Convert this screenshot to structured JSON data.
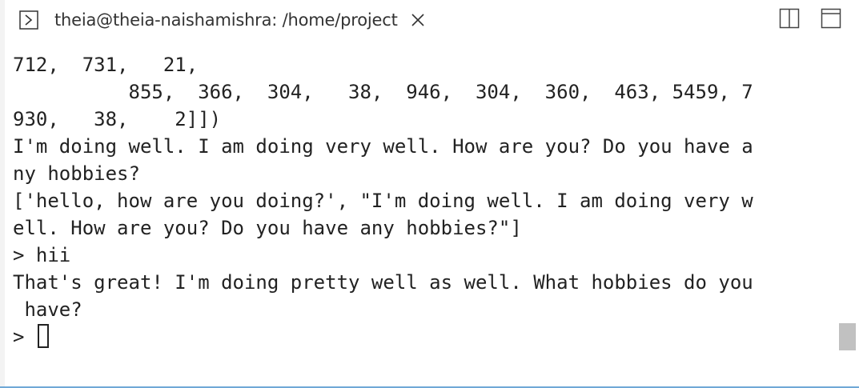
{
  "tab": {
    "icon": "terminal-icon",
    "title": "theia@theia-naishamishra: /home/project",
    "close_icon": "close-icon"
  },
  "toolbar": {
    "split_icon": "split-editor-icon",
    "maximize_icon": "maximize-panel-icon"
  },
  "terminal": {
    "lines": [
      "712,  731,   21,",
      "          855,  366,  304,   38,  946,  304,  360,  463, 5459, 7",
      "930,   38,    2]])",
      "I'm doing well. I am doing very well. How are you? Do you have a",
      "ny hobbies?",
      "['hello, how are you doing?', \"I'm doing well. I am doing very w",
      "ell. How are you? Do you have any hobbies?\"]",
      "> hii",
      "That's great! I'm doing pretty well as well. What hobbies do you",
      " have?"
    ],
    "prompt": "> "
  }
}
